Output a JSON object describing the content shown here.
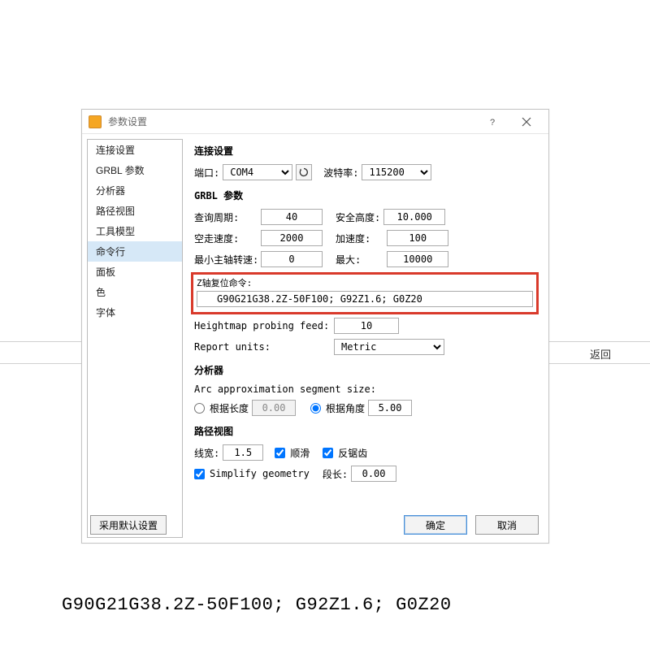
{
  "background": {
    "return_label": "返回"
  },
  "titlebar": {
    "title": "参数设置"
  },
  "sidebar": {
    "items": [
      {
        "label": "连接设置"
      },
      {
        "label": "GRBL 参数"
      },
      {
        "label": "分析器"
      },
      {
        "label": "路径视图"
      },
      {
        "label": "工具模型"
      },
      {
        "label": "命令行",
        "selected": true
      },
      {
        "label": "面板"
      },
      {
        "label": "色"
      },
      {
        "label": "字体"
      }
    ]
  },
  "content": {
    "conn": {
      "title": "连接设置",
      "port_label": "端口:",
      "port_value": "COM4",
      "baud_label": "波特率:",
      "baud_value": "115200"
    },
    "grbl": {
      "title": "GRBL 参数",
      "poll_label": "查询周期:",
      "poll_value": "40",
      "safe_label": "安全高度:",
      "safe_value": "10.000",
      "idle_label": "空走速度:",
      "idle_value": "2000",
      "accel_label": "加速度:",
      "accel_value": "100",
      "spindle_min_label": "最小主轴转速:",
      "spindle_min_value": "0",
      "spindle_max_label": "最大:",
      "spindle_max_value": "10000"
    },
    "z_reset": {
      "label": "Z轴复位命令:",
      "value": "G90G21G38.2Z-50F100; G92Z1.6; G0Z20"
    },
    "heightmap": {
      "label": "Heightmap probing feed:",
      "value": "10"
    },
    "report": {
      "label": "Report units:",
      "value": "Metric"
    },
    "analyzer": {
      "title": "分析器",
      "arc_label": "Arc approximation segment size:",
      "by_length_label": "根据长度",
      "by_length_value": "0.00",
      "by_angle_label": "根据角度",
      "by_angle_value": "5.00"
    },
    "pathview": {
      "title": "路径视图",
      "linewidth_label": "线宽:",
      "linewidth_value": "1.5",
      "smooth_label": "顺滑",
      "antialias_label": "反锯齿",
      "simplify_label": "Simplify geometry",
      "segment_label": "段长:",
      "segment_value": "0.00"
    }
  },
  "footer": {
    "defaults": "采用默认设置",
    "ok": "确定",
    "cancel": "取消"
  },
  "bottom_code": "G90G21G38.2Z-50F100; G92Z1.6; G0Z20"
}
